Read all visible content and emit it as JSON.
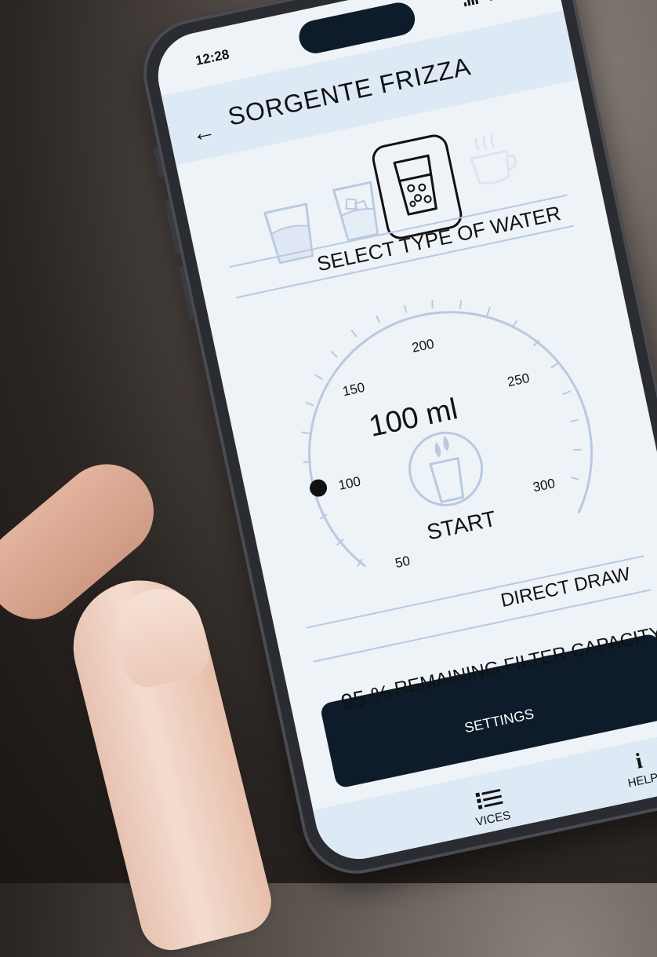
{
  "status_bar": {
    "time": "12:28"
  },
  "header": {
    "title": "SORGENTE FRIZZA",
    "back_icon": "arrow-left-icon"
  },
  "water_types": {
    "label": "SELECT TYPE OF WATER",
    "items": [
      {
        "name": "still-water-glass-icon",
        "selected": false
      },
      {
        "name": "chilled-water-glass-icon",
        "selected": false
      },
      {
        "name": "sparkling-water-glass-icon",
        "selected": true
      },
      {
        "name": "hot-water-cup-icon",
        "selected": false
      }
    ]
  },
  "gauge": {
    "current": "100 ml",
    "min": 50,
    "max": 300,
    "value": 100,
    "ticks": [
      "50",
      "100",
      "150",
      "200",
      "250",
      "300"
    ],
    "start_label": "START"
  },
  "direct_draw": {
    "label": "DIRECT DRAW"
  },
  "filter": {
    "percent": "95 %",
    "label": "REMAINING FILTER CAPACITY"
  },
  "settings": {
    "label": "SETTINGS"
  },
  "nav": {
    "devices": "VICES",
    "help_icon_glyph": "i",
    "help": "HELP"
  },
  "colors": {
    "accent": "#b9c9e2",
    "dark": "#0d1b2a",
    "header_bg": "#dde9f4",
    "screen_bg": "#eef3f7"
  }
}
